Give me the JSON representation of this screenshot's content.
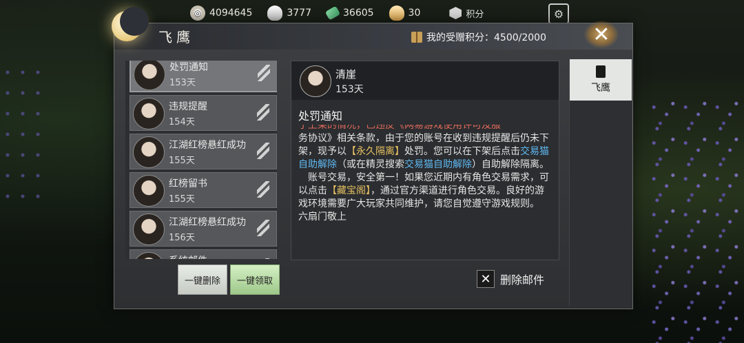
{
  "topbar": {
    "currencies": [
      {
        "icon": "coin-icon",
        "value": "4094645"
      },
      {
        "icon": "silver-bowl-icon",
        "value": "3777"
      },
      {
        "icon": "jade-icon",
        "value": "36605"
      },
      {
        "icon": "gold-bowl-icon",
        "value": "30"
      }
    ],
    "points_label": "积分"
  },
  "window": {
    "title": "飞鹰",
    "gift_points": "我的受赠积分：4500/2000"
  },
  "mail_list": [
    {
      "title": "处罚通知",
      "days": "153天",
      "selected": true
    },
    {
      "title": "违规提醒",
      "days": "154天",
      "selected": false
    },
    {
      "title": "江湖红榜悬红成功",
      "days": "155天",
      "selected": false
    },
    {
      "title": "红榜留书",
      "days": "155天",
      "selected": false
    },
    {
      "title": "江湖红榜悬红成功",
      "days": "156天",
      "selected": false
    },
    {
      "title": "系统邮件",
      "days": "",
      "selected": false
    }
  ],
  "buttons": {
    "delete_all": "一键删除",
    "collect_all": "一键领取",
    "delete_mail": "删除邮件"
  },
  "mail": {
    "sender": "清崖",
    "days": "153天",
    "subject": "处罚通知",
    "cutoff_line": "于上架的情况，已违反《网易游戏使用许可及服",
    "p1_a": "务协议》相关条款，由于您的账号在收到违规提醒后仍未下架，现予以",
    "p1_hl1": "【永久隔离】",
    "p1_b": "处罚。您可以在下架后点击",
    "p1_hl2": "交易猫自助解除",
    "p1_c": "（或在精灵搜索",
    "p1_hl3": "交易猫自助解除",
    "p1_d": "）自助解除隔离。",
    "p2_a": "账号交易，安全第一！如果您近期内有角色交易需求，可以点击",
    "p2_hl": "【藏宝阁】",
    "p2_b": "，通过官方渠道进行角色交易。良好的游戏环境需要广大玩家共同维护，请您自觉遵守游戏规则。",
    "signature": "六扇门敬上"
  },
  "side_tabs": [
    {
      "label": "飞鹰"
    }
  ]
}
